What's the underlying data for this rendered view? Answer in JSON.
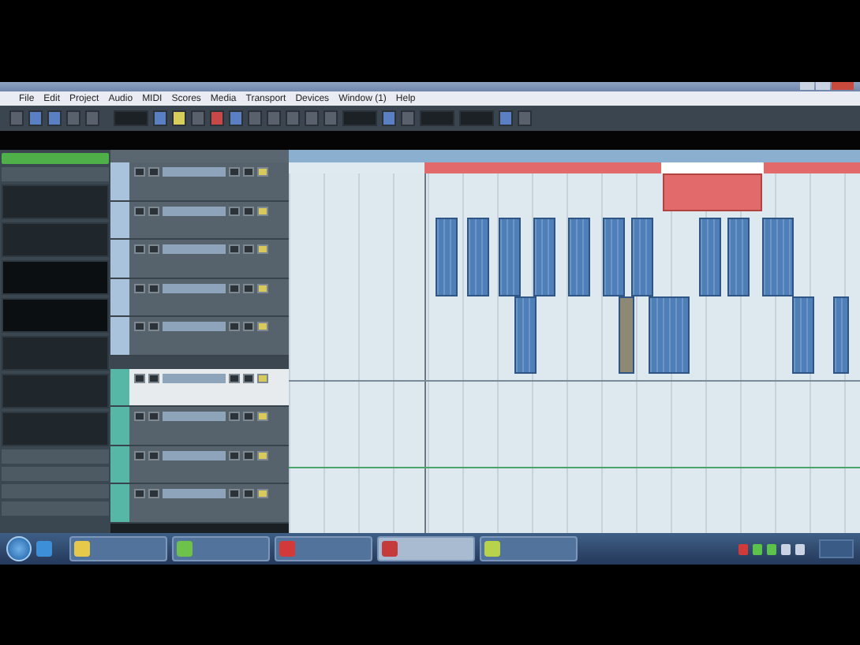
{
  "menu": [
    "File",
    "Edit",
    "Project",
    "Audio",
    "MIDI",
    "Scores",
    "Media",
    "Transport",
    "Devices",
    "Window (1)",
    "Help"
  ],
  "tracks": [
    {
      "kind": "audio",
      "selected": false
    },
    {
      "kind": "audio",
      "selected": false
    },
    {
      "kind": "audio",
      "selected": false
    },
    {
      "kind": "audio",
      "selected": false
    },
    {
      "kind": "audio",
      "selected": false
    },
    {
      "kind": "instrument",
      "selected": true
    },
    {
      "kind": "instrument",
      "selected": false
    },
    {
      "kind": "instrument",
      "selected": false
    },
    {
      "kind": "instrument",
      "selected": false
    }
  ]
}
